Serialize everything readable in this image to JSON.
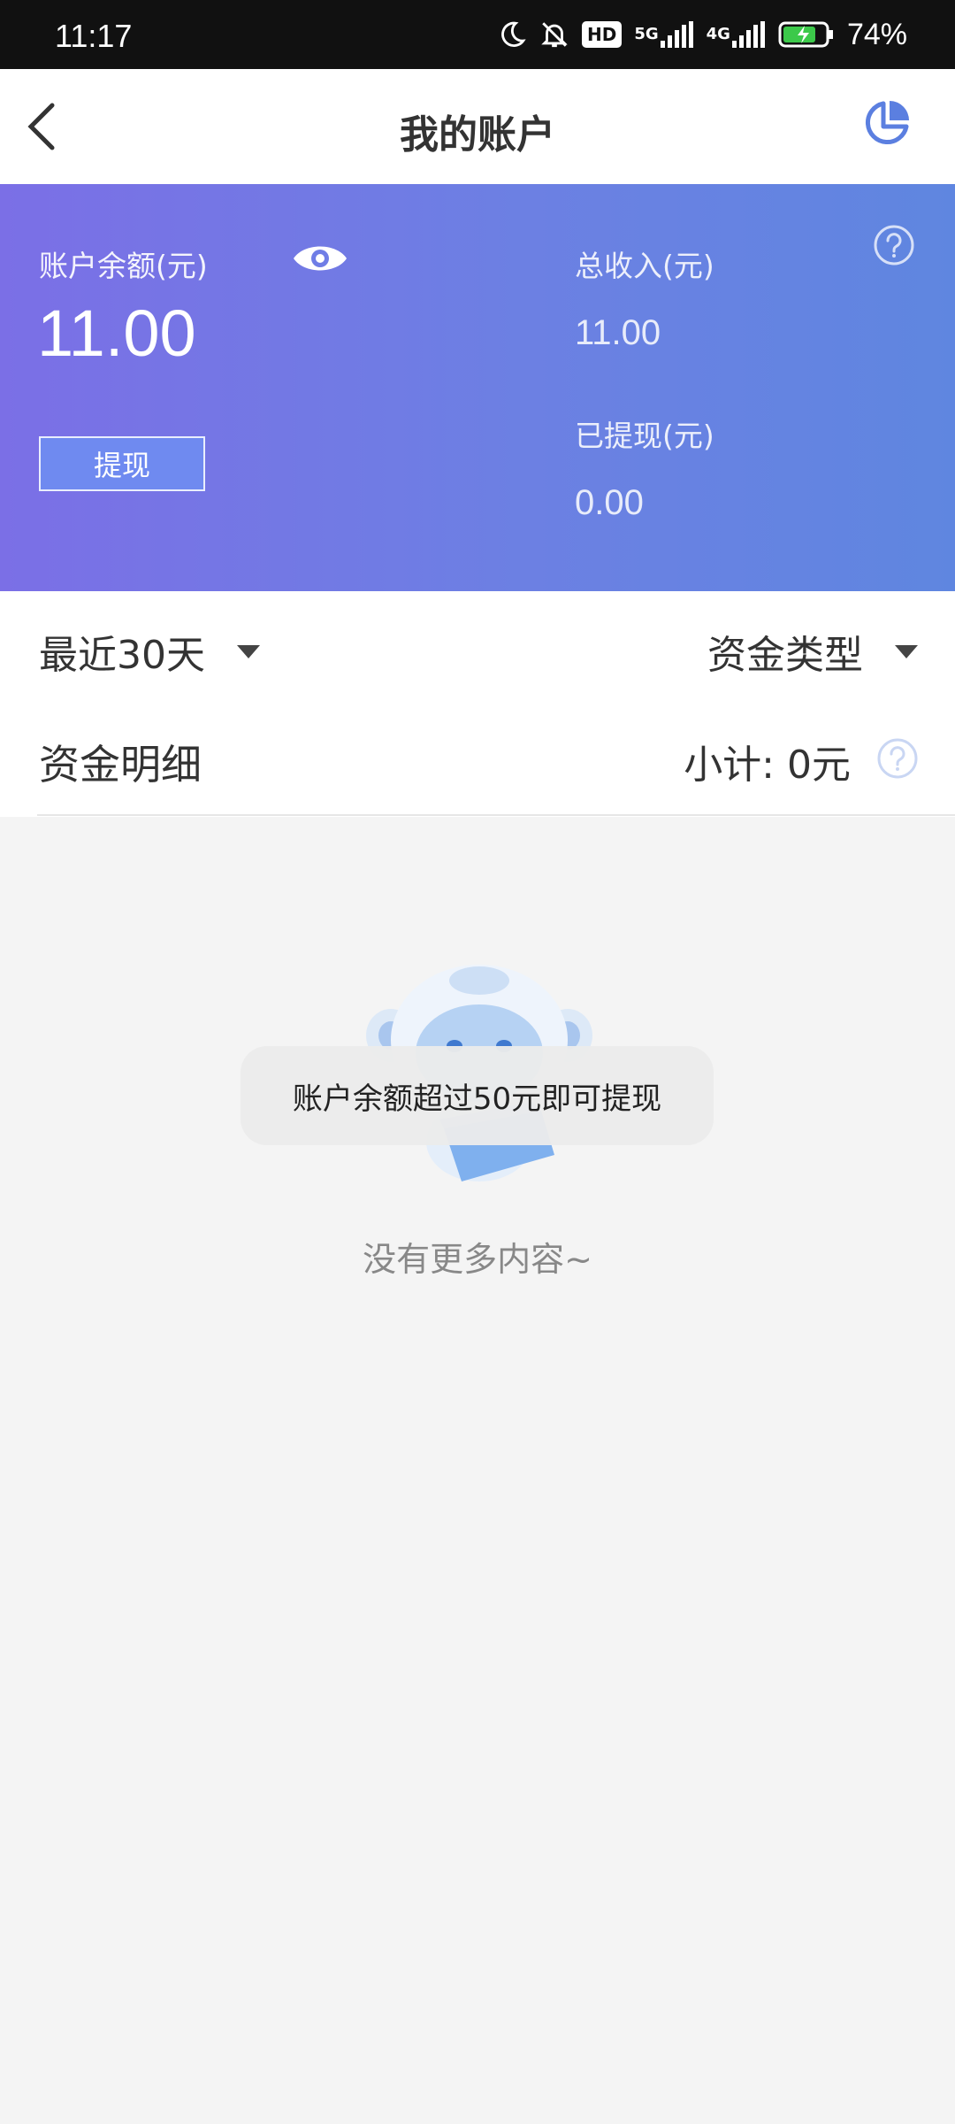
{
  "status_bar": {
    "time": "11:17",
    "icons": [
      "moon-icon",
      "bell-off-icon",
      "hd-icon",
      "signal-5g-icon",
      "signal-4g-icon",
      "battery-icon"
    ],
    "hd_label": "HD",
    "net1_label": "5G",
    "net2_label": "4G",
    "battery_percent": "74%"
  },
  "header": {
    "title": "我的账户",
    "back_icon": "chevron-left-icon",
    "stats_icon": "pie-chart-icon"
  },
  "balance": {
    "label": "账户余额(元)",
    "value": "11.00",
    "withdraw_button": "提现",
    "total_income_label": "总收入(元)",
    "total_income_value": "11.00",
    "withdrawn_label": "已提现(元)",
    "withdrawn_value": "0.00"
  },
  "filters": {
    "date_range": "最近30天",
    "fund_type": "资金类型"
  },
  "details": {
    "title": "资金明细",
    "subtotal": "小计: 0元"
  },
  "toast": {
    "message": "账户余额超过50元即可提现"
  },
  "empty": {
    "text": "没有更多内容~"
  },
  "colors": {
    "card_gradient_start": "#7b6fe6",
    "card_gradient_end": "#5f86e0",
    "accent": "#5b7fe0",
    "background": "#f4f4f4"
  }
}
